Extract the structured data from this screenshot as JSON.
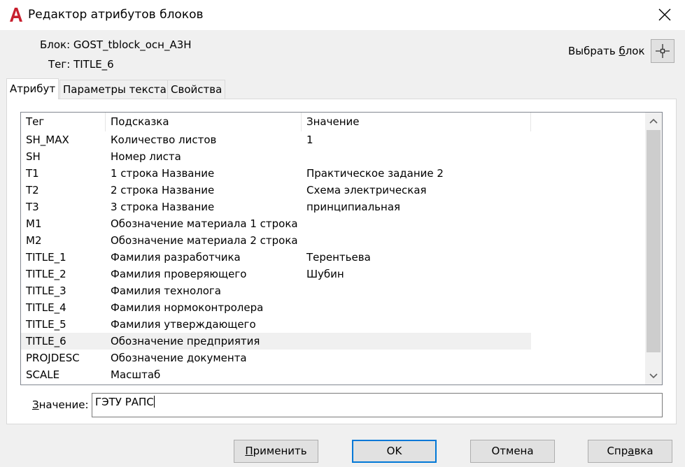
{
  "window": {
    "title": "Редактор атрибутов блоков",
    "icon": "autocad-a-icon",
    "close_icon": "close-icon"
  },
  "block_info": {
    "block_label": "Блок: GOST_tblock_осн_A3H",
    "tag_label": "Тег: TITLE_6"
  },
  "pick_block": {
    "label_prefix": "Выбрать ",
    "label_underlined": "б",
    "label_suffix": "лок",
    "icon": "crosshair-icon"
  },
  "tabs": [
    {
      "label": "Атрибут",
      "active": true
    },
    {
      "label": "Параметры текста",
      "active": false
    },
    {
      "label": "Свойства",
      "active": false
    }
  ],
  "table": {
    "headers": [
      "Тег",
      "Подсказка",
      "Значение"
    ],
    "selected_index": 12,
    "rows": [
      [
        "SH_MAX",
        "Количество листов",
        "1"
      ],
      [
        "SH",
        "Номер листа",
        ""
      ],
      [
        "T1",
        "1 строка Название",
        "Практическое задание 2"
      ],
      [
        "T2",
        "2 строка Название",
        "Схема электрическая"
      ],
      [
        "T3",
        "3 строка Название",
        "принципиальная"
      ],
      [
        "M1",
        "Обозначение материала 1 строка",
        ""
      ],
      [
        "M2",
        "Обозначение материала 2 строка",
        ""
      ],
      [
        "TITLE_1",
        "Фамилия разработчика",
        "Терентьева"
      ],
      [
        "TITLE_2",
        "Фамилия проверяющего",
        "Шубин"
      ],
      [
        "TITLE_3",
        "Фамилия технолога",
        ""
      ],
      [
        "TITLE_4",
        "Фамилия нормоконтролера",
        ""
      ],
      [
        "TITLE_5",
        "Фамилия утверждающего",
        ""
      ],
      [
        "TITLE_6",
        "Обозначение предприятия",
        ""
      ],
      [
        "PROJDESC",
        "Обозначение документа",
        ""
      ],
      [
        "SCALE",
        "Масштаб",
        ""
      ]
    ]
  },
  "value_field": {
    "label_underlined": "З",
    "label_rest": "начение:",
    "value": "ГЭТУ РАПС"
  },
  "buttons": {
    "apply_underlined": "П",
    "apply_rest": "рименить",
    "ok": "OK",
    "cancel": "Отмена",
    "help_prefix": "Спр",
    "help_underlined": "а",
    "help_suffix": "вка"
  },
  "colors": {
    "accent": "#0078d7",
    "autocad_red": "#c8202f"
  }
}
